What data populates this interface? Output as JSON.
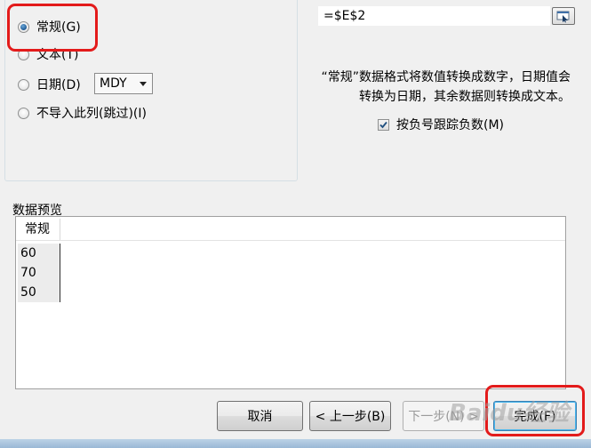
{
  "column_format": {
    "options": [
      {
        "label": "常规(G)",
        "checked": true
      },
      {
        "label": "文本(T)",
        "checked": false
      },
      {
        "label": "日期(D)",
        "checked": false
      },
      {
        "label": "不导入此列(跳过)(I)",
        "checked": false
      }
    ],
    "date_format": "MDY"
  },
  "destination": {
    "value": "=$E$2"
  },
  "description": "“常规”数据格式将数值转换成数字，日期值会转换为日期，其余数据则转换成文本。",
  "negative_sign_checkbox": {
    "label": "按负号跟踪负数(M)",
    "checked": true
  },
  "preview": {
    "label": "数据预览",
    "column_header": "常规",
    "rows": [
      "60",
      "70",
      "50"
    ]
  },
  "buttons": {
    "cancel": "取消",
    "back": "< 上一步(B)",
    "next": "下一步(N) >",
    "finish": "完成(F)"
  },
  "watermark": "Baidu经验",
  "colors": {
    "highlight": "#e31b1b",
    "radio_selected": "#1f5a94"
  }
}
